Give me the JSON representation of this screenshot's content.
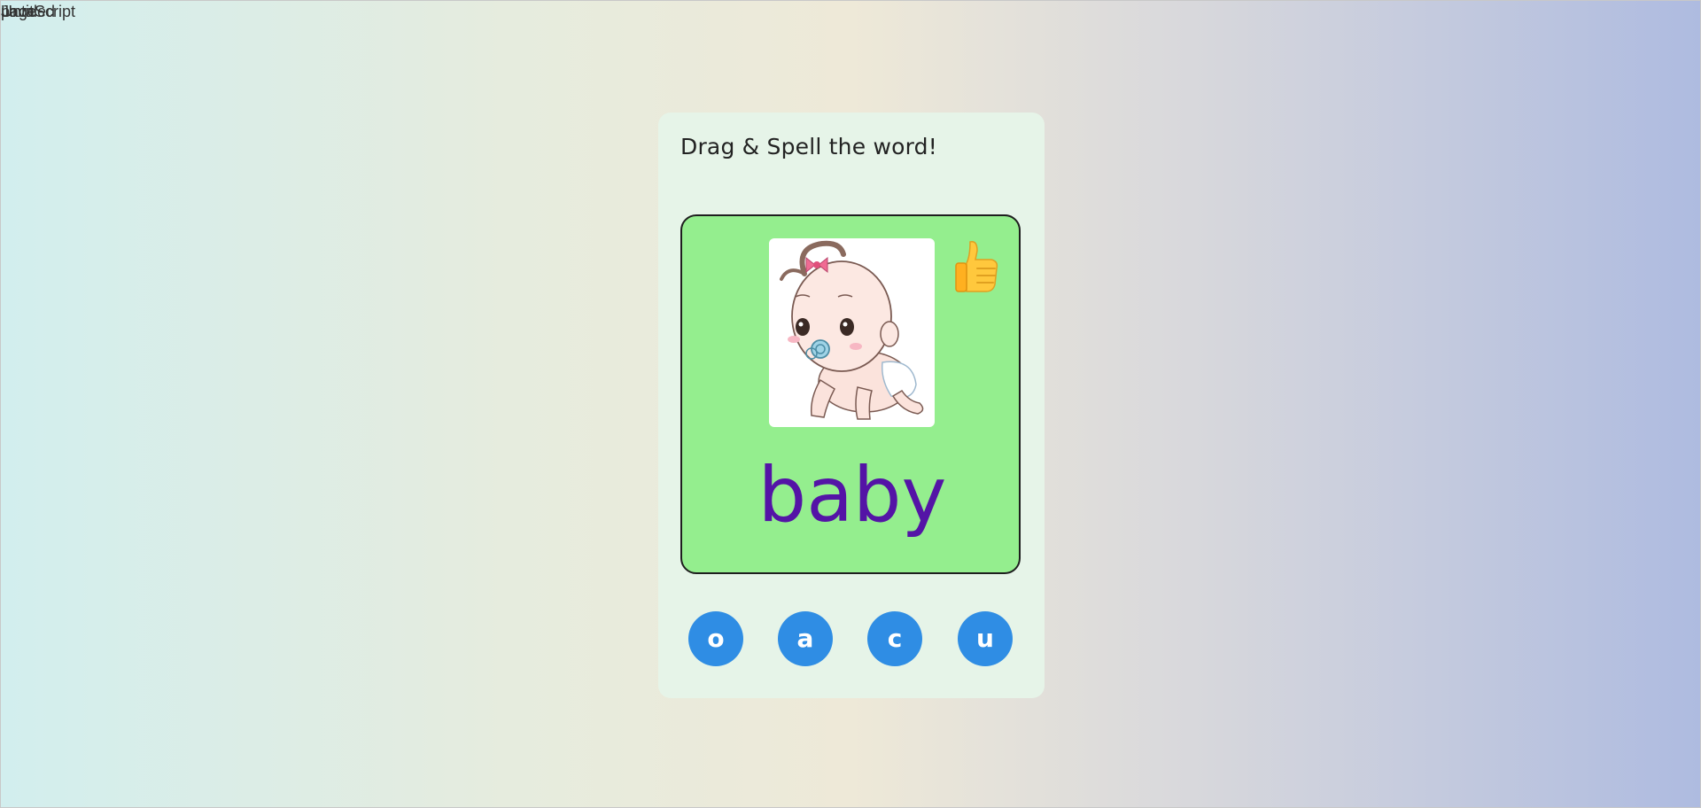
{
  "header_labels": [
    "Untitled",
    "page",
    "JavaScript"
  ],
  "game": {
    "instruction": "Drag & Spell the word!",
    "word": "baby",
    "picture_icon": "crawling-baby-illustration",
    "feedback_icon": "thumbs-up-icon",
    "letters": [
      "o",
      "a",
      "c",
      "u"
    ]
  },
  "colors": {
    "card_background": "#94ee8e",
    "panel_background": "#e6f4e8",
    "word_color": "#5414a6",
    "tile_color": "#2f8de4"
  }
}
